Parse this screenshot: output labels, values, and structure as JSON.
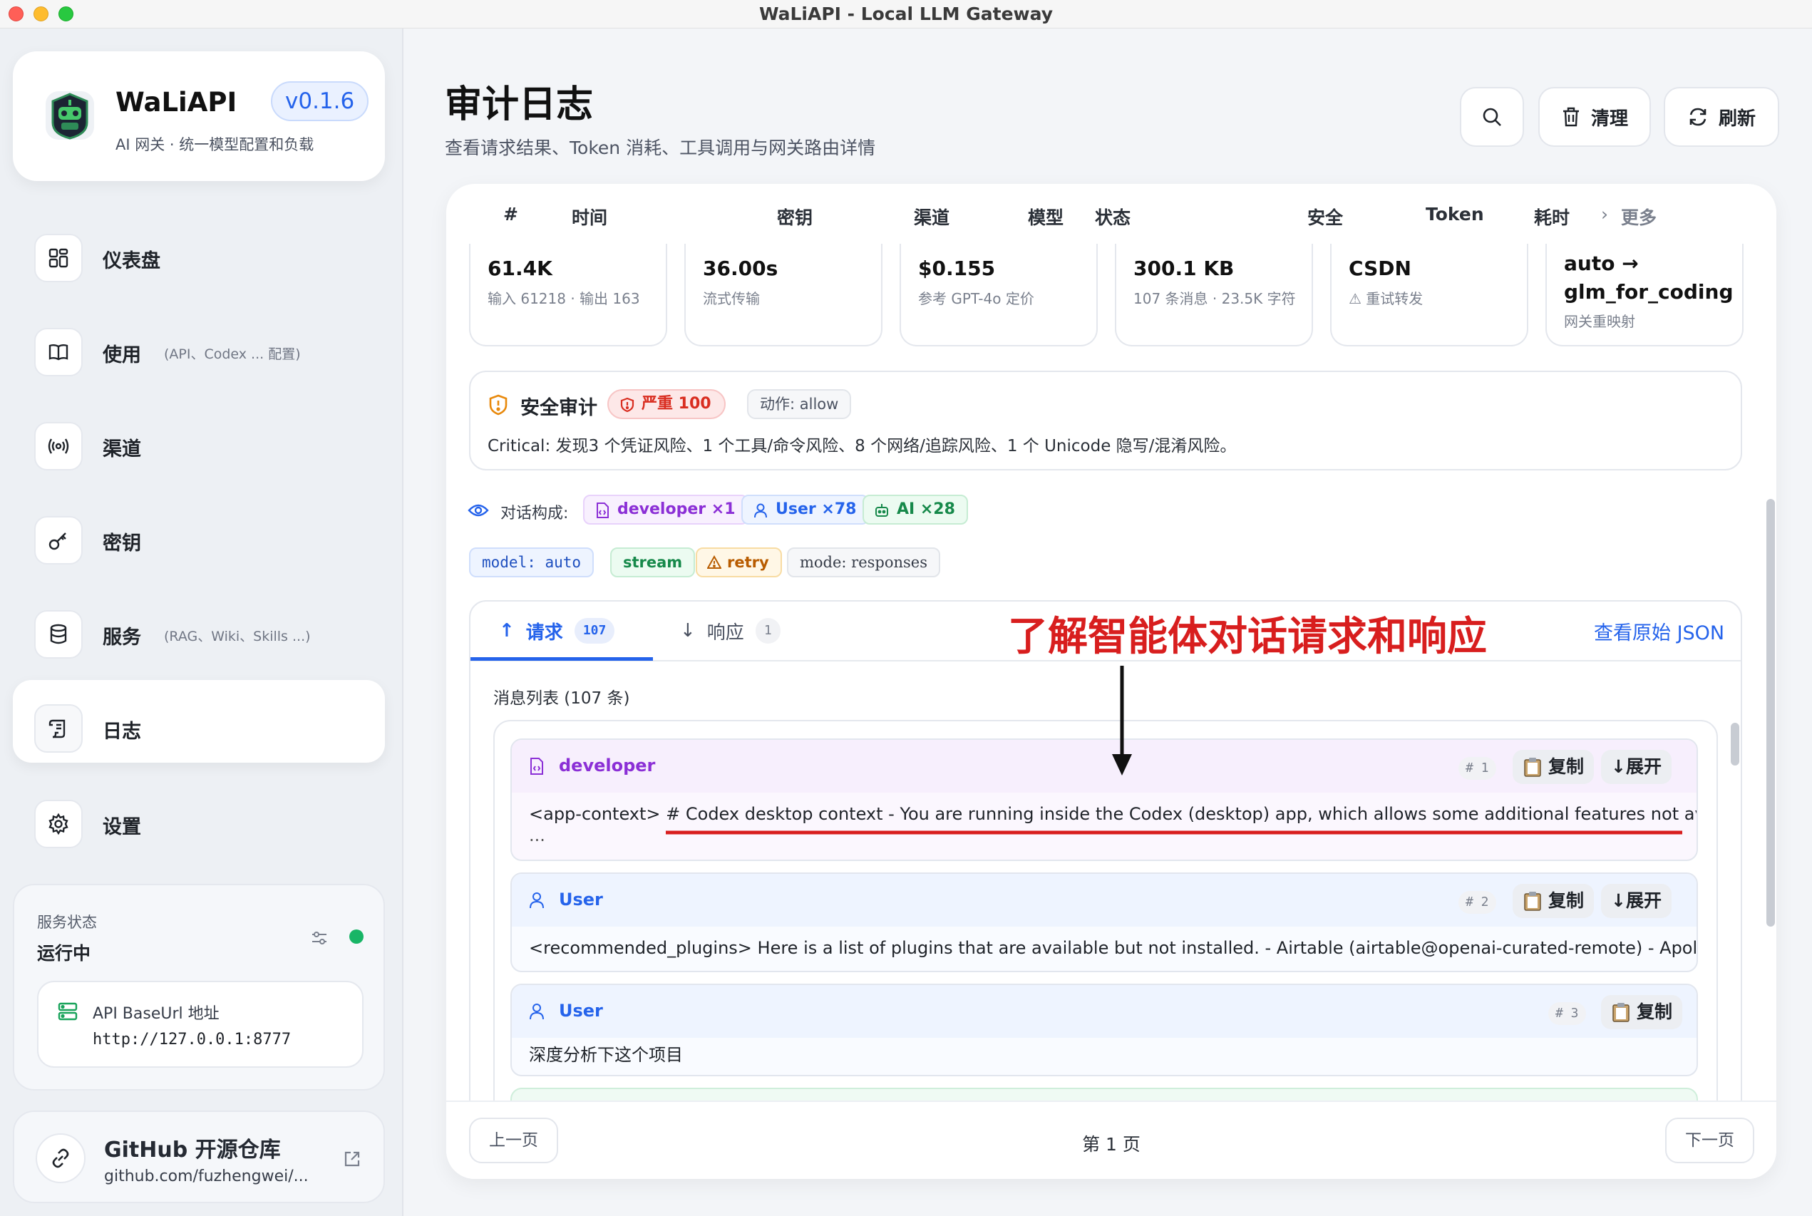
{
  "window": {
    "title": "WaLiAPI - Local LLM Gateway"
  },
  "brand": {
    "name": "WaLiAPI",
    "version": "v0.1.6",
    "subtitle": "AI 网关 · 统一模型配置和负载"
  },
  "nav": [
    {
      "label": "仪表盘",
      "hint": "",
      "icon": "dashboard-icon"
    },
    {
      "label": "使用",
      "hint": "(API、Codex ... 配置)",
      "icon": "book-icon"
    },
    {
      "label": "渠道",
      "hint": "",
      "icon": "broadcast-icon"
    },
    {
      "label": "密钥",
      "hint": "",
      "icon": "key-icon"
    },
    {
      "label": "服务",
      "hint": "(RAG、Wiki、Skills ...)",
      "icon": "database-icon"
    },
    {
      "label": "日志",
      "hint": "",
      "icon": "scroll-icon",
      "active": true
    },
    {
      "label": "设置",
      "hint": "",
      "icon": "gear-icon"
    }
  ],
  "service": {
    "title": "服务状态",
    "value": "运行中",
    "api_label": "API BaseUrl 地址",
    "api_url": "http://127.0.0.1:8777"
  },
  "github": {
    "title": "GitHub 开源仓库",
    "url": "github.com/fuzhengwei/..."
  },
  "page": {
    "title": "审计日志",
    "subtitle": "查看请求结果、Token 消耗、工具调用与网关路由详情"
  },
  "toolbar": {
    "clean_label": "清理",
    "refresh_label": "刷新"
  },
  "columns": [
    "#",
    "时间",
    "密钥",
    "渠道",
    "模型",
    "状态",
    "安全",
    "Token",
    "耗时",
    "更多"
  ],
  "stats": [
    {
      "value": "61.4K",
      "sub": "输入 61218 · 输出 163"
    },
    {
      "value": "36.00s",
      "sub": "流式传输"
    },
    {
      "value": "$0.155",
      "sub": "参考 GPT-4o 定价"
    },
    {
      "value": "300.1 KB",
      "sub": "107 条消息 · 23.5K 字符"
    },
    {
      "value": "CSDN",
      "sub": "⚠ 重试转发"
    },
    {
      "value": "auto → glm_for_coding",
      "sub": "网关重映射"
    }
  ],
  "audit": {
    "title": "安全审计",
    "severity": "严重 100",
    "action": "动作: allow",
    "text": "Critical: 发现3 个凭证风险、1 个工具/命令风险、8 个网络/追踪风险、1 个 Unicode 隐写/混淆风险。"
  },
  "composition": {
    "label": "对话构成:",
    "developer": "developer ×1",
    "user": "User ×78",
    "ai": "AI ×28"
  },
  "tags": {
    "model": "model: auto",
    "stream": "stream",
    "retry": "retry",
    "mode": "mode: responses"
  },
  "tabs": {
    "request_label": "请求",
    "request_count": "107",
    "response_label": "响应",
    "response_count": "1",
    "raw_json": "查看原始 JSON"
  },
  "annotation": "了解智能体对话请求和响应",
  "messages_title": "消息列表 (107 条)",
  "messages": [
    {
      "role": "developer",
      "index": "# 1",
      "copy": "复制",
      "expand": "↓展开",
      "text": "<app-context> # Codex desktop context - You are running inside the Codex (desktop) app, which allows some additional features not available",
      "text2": "..."
    },
    {
      "role": "User",
      "index": "# 2",
      "copy": "复制",
      "expand": "↓展开",
      "text": "<recommended_plugins> Here is a list of plugins that are available but not installed. - Airtable (airtable@openai-curated-remote) - Apollo.i..."
    },
    {
      "role": "User",
      "index": "# 3",
      "copy": "复制",
      "text": "深度分析下这个项目"
    }
  ],
  "pager": {
    "prev": "上一页",
    "page": "第 1 页",
    "next": "下一页"
  }
}
